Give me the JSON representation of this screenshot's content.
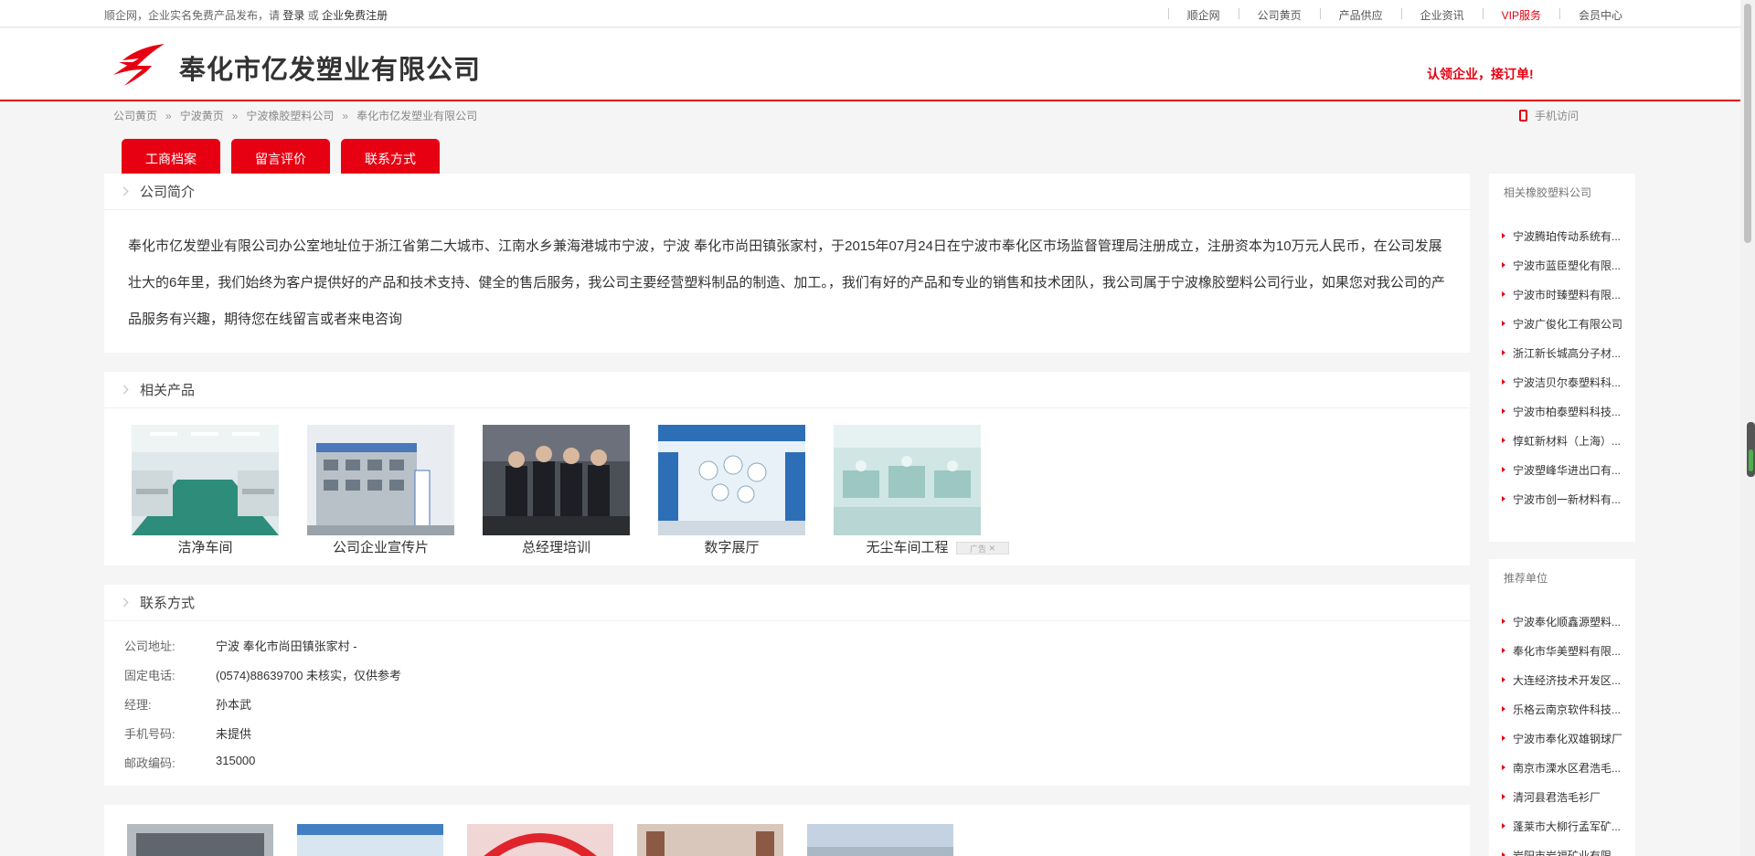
{
  "topbar": {
    "notice": "顺企网，企业实名免费产品发布，请",
    "login": "登录",
    "or": "或",
    "register": "企业免费注册",
    "links": [
      "顺企网",
      "公司黄页",
      "产品供应",
      "企业资讯",
      "VIP服务",
      "会员中心"
    ]
  },
  "header": {
    "company_name": "奉化市亿发塑业有限公司",
    "claim": "认领企业，接订单!"
  },
  "breadcrumb": [
    "公司黄页",
    "宁波黄页",
    "宁波橡胶塑料公司",
    "奉化市亿发塑业有限公司"
  ],
  "mobile_label": "手机访问",
  "tabs": [
    "工商档案",
    "留言评价",
    "联系方式"
  ],
  "intro": {
    "title": "公司简介",
    "text": "奉化市亿发塑业有限公司办公室地址位于浙江省第二大城市、江南水乡兼海港城市宁波，宁波 奉化市尚田镇张家村，于2015年07月24日在宁波市奉化区市场监督管理局注册成立，注册资本为10万元人民币，在公司发展壮大的6年里，我们始终为客户提供好的产品和技术支持、健全的售后服务，我公司主要经营塑料制品的制造、加工。，我们有好的产品和专业的销售和技术团队，我公司属于宁波橡胶塑料公司行业，如果您对我公司的产品服务有兴趣，期待您在线留言或者来电咨询"
  },
  "products": {
    "title": "相关产品",
    "items": [
      {
        "caption": "洁净车间",
        "icon": "clean-room-photo"
      },
      {
        "caption": "公司企业宣传片",
        "icon": "office-building-photo"
      },
      {
        "caption": "总经理培训",
        "icon": "group-photo"
      },
      {
        "caption": "数字展厅",
        "icon": "showroom-photo"
      },
      {
        "caption": "无尘车间工程",
        "icon": "dustfree-workshop-photo"
      }
    ],
    "ad_label": "广告"
  },
  "contact": {
    "title": "联系方式",
    "rows": [
      {
        "key": "公司地址:",
        "value": "宁波 奉化市尚田镇张家村 -"
      },
      {
        "key": "固定电话:",
        "value": "(0574)88639700 未核实，仅供参考"
      },
      {
        "key": "经理:",
        "value": "孙本武"
      },
      {
        "key": "手机号码:",
        "value": "未提供"
      },
      {
        "key": "邮政编码:",
        "value": "315000"
      }
    ]
  },
  "sidebar_related": {
    "title": "相关橡胶塑料公司",
    "items": [
      "宁波腾珀传动系统有...",
      "宁波市蓝臣塑化有限...",
      "宁波市时臻塑料有限...",
      "宁波广俊化工有限公司",
      "浙江新长城高分子材...",
      "宁波洁贝尔泰塑料科...",
      "宁波市柏泰塑料科技...",
      "惇虹新材料（上海）...",
      "宁波塑峰华进出口有...",
      "宁波市创一新材料有..."
    ]
  },
  "sidebar_recommended": {
    "title": "推荐单位",
    "items": [
      "宁波奉化顺鑫源塑料...",
      "奉化市华美塑料有限...",
      "大连经济技术开发区...",
      "乐格云南京软件科技...",
      "宁波市奉化双雄钢球厂",
      "南京市溧水区君浩毛...",
      "清河县君浩毛衫厂",
      "蓬莱市大柳行孟军矿...",
      "岩阳市岩福矿业有限"
    ]
  },
  "colors": {
    "accent": "#e60012"
  }
}
